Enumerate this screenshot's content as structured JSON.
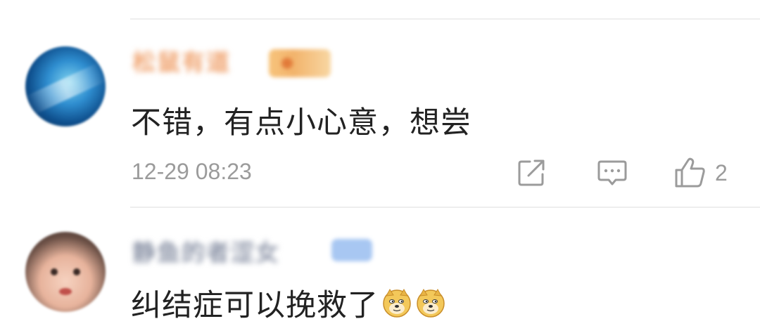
{
  "comments": [
    {
      "username": "松鼠有道",
      "text": "不错，有点小心意，想尝",
      "timestamp": "12-29 08:23",
      "like_count": "2"
    },
    {
      "username": "静鱼的者涩女",
      "text": "纠结症可以挽救了",
      "emojis": [
        "doge-emoji",
        "doge-emoji"
      ]
    }
  ],
  "icons": {
    "share": "share-icon",
    "reply": "comment-icon",
    "like": "thumbs-up-icon"
  },
  "colors": {
    "text": "#222222",
    "meta": "#9b9b9b",
    "username_vip": "#f0a36f",
    "divider": "#eeeeee"
  }
}
